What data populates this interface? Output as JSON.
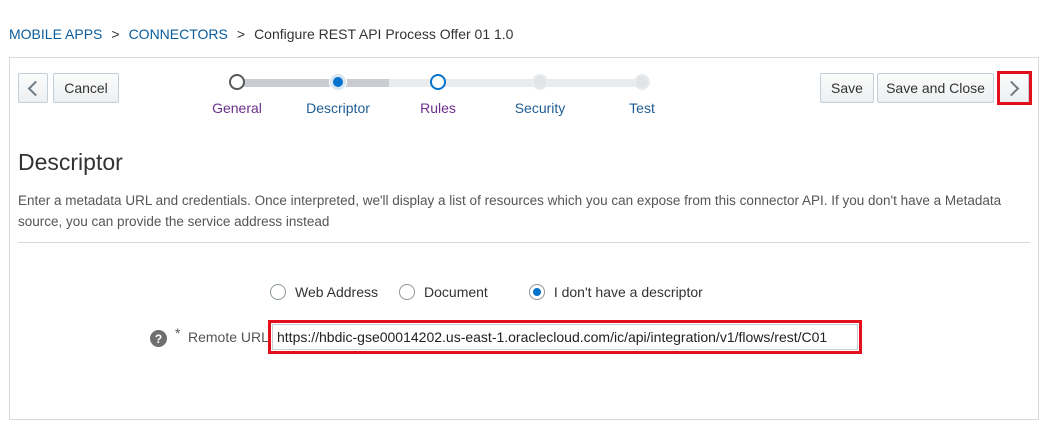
{
  "breadcrumb": {
    "items": [
      "MOBILE APPS",
      "CONNECTORS",
      "Configure REST API  Process Offer 01 1.0"
    ],
    "separator": ">"
  },
  "toolbar": {
    "back_icon": "chevron-left-icon",
    "cancel_label": "Cancel",
    "save_label": "Save",
    "save_close_label": "Save and Close",
    "next_icon": "chevron-right-icon"
  },
  "train": {
    "steps": [
      {
        "label": "General",
        "state": "visited"
      },
      {
        "label": "Descriptor",
        "state": "current"
      },
      {
        "label": "Rules",
        "state": "available"
      },
      {
        "label": "Security",
        "state": "disabled"
      },
      {
        "label": "Test",
        "state": "disabled"
      }
    ]
  },
  "section": {
    "title": "Descriptor",
    "description": "Enter a metadata URL and credentials. Once interpreted, we'll display a list of resources which you can expose from this connector API. If you don't have a Metadata source, you can provide the service address instead"
  },
  "descriptor_options": {
    "options": [
      "Web Address",
      "Document",
      "I don't have a descriptor"
    ],
    "selected_index": 2
  },
  "remote_url": {
    "help_icon": "question-circle-icon",
    "required_marker": "*",
    "label": "Remote URL",
    "value": "https://hbdic-gse00014202.us-east-1.oraclecloud.com/ic/api/integration/v1/flows/rest/C01"
  },
  "colors": {
    "link": "#0a5c9c",
    "visited": "#6c2f8a",
    "current": "#0572ce",
    "disabled": "#cfd4d8",
    "highlight": "#e3101b"
  }
}
